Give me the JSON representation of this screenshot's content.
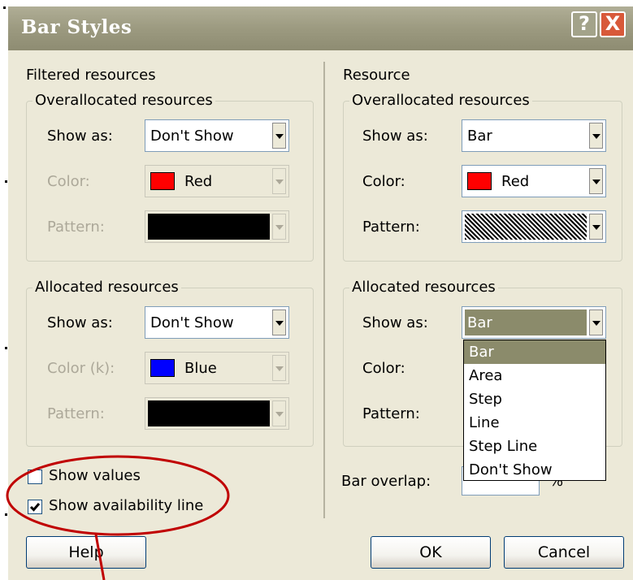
{
  "window": {
    "title": "Bar Styles",
    "help_button": "?",
    "close_button": "X"
  },
  "filtered": {
    "section_label": "Filtered resources",
    "over": {
      "group_label": "Overallocated resources",
      "show_as_label": "Show as:",
      "show_as_value": "Don't Show",
      "color_label": "Color:",
      "color_value": "Red",
      "color_hex": "#ff0000",
      "pattern_label": "Pattern:"
    },
    "alloc": {
      "group_label": "Allocated resources",
      "show_as_label": "Show as:",
      "show_as_value": "Don't Show",
      "color_label": "Color (k):",
      "color_value": "Blue",
      "color_hex": "#0000ff",
      "pattern_label": "Pattern:"
    },
    "show_values_label": "Show values",
    "show_values_checked": false,
    "show_availability_label": "Show availability line",
    "show_availability_checked": true
  },
  "resource": {
    "section_label": "Resource",
    "over": {
      "group_label": "Overallocated resources",
      "show_as_label": "Show as:",
      "show_as_value": "Bar",
      "color_label": "Color:",
      "color_value": "Red",
      "color_hex": "#ff0000",
      "pattern_label": "Pattern:"
    },
    "alloc": {
      "group_label": "Allocated resources",
      "show_as_label": "Show as:",
      "show_as_value": "Bar",
      "color_label": "Color:",
      "pattern_label": "Pattern:",
      "dropdown_options": [
        "Bar",
        "Area",
        "Step",
        "Line",
        "Step Line",
        "Don't Show"
      ],
      "dropdown_selected": "Bar"
    },
    "bar_overlap_label": "Bar overlap:",
    "bar_overlap_unit": "%"
  },
  "buttons": {
    "help": "Help",
    "ok": "OK",
    "cancel": "Cancel"
  },
  "annotation_color": "#c00000"
}
